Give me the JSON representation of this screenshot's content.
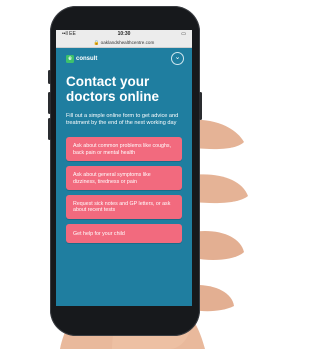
{
  "status_bar": {
    "signal": "••ll EE",
    "time": "10:30",
    "battery": "▭"
  },
  "browser": {
    "url": "🔒 oaklandshealthcentre.com"
  },
  "app": {
    "logo_mark": "e",
    "logo_text": "consult",
    "menu_icon": "chevron-down-icon",
    "title": "Contact your doctors online",
    "intro": "Fill out a simple online form to get advice and treatment by the end of the next working day",
    "options": [
      {
        "label": "Ask about common problems like coughs, back pain or mental health"
      },
      {
        "label": "Ask about general symptoms like dizziness, tiredness or pain"
      },
      {
        "label": "Request sick notes and GP letters, or ask about recent tests"
      },
      {
        "label": "Get help for your child"
      }
    ]
  },
  "colors": {
    "screen_bg": "#1f7ea0",
    "option_bg": "#f26a7e",
    "logo_green": "#3ec26b"
  }
}
